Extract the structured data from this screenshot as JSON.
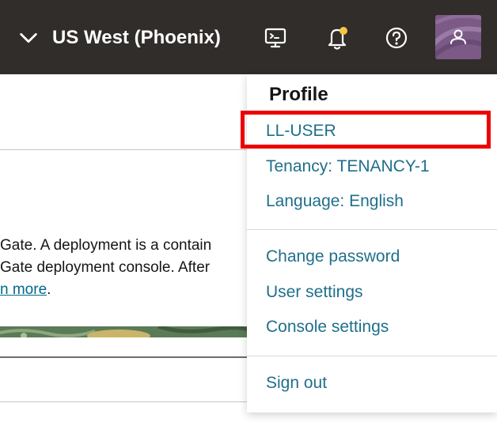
{
  "header": {
    "region_label": "US West (Phoenix)",
    "icons": [
      "cloud-shell-icon",
      "bell-icon",
      "help-icon",
      "user-icon"
    ]
  },
  "background": {
    "line1": "Gate. A deployment is a contain",
    "line2": "Gate deployment console. After",
    "link_text": "n more",
    "link_suffix": "."
  },
  "profile_menu": {
    "title": "Profile",
    "user": "LL-USER",
    "tenancy": "Tenancy: TENANCY-1",
    "language": "Language: English",
    "change_password": "Change password",
    "user_settings": "User settings",
    "console_settings": "Console settings",
    "sign_out": "Sign out"
  },
  "colors": {
    "header_bg": "#312d2a",
    "link": "#1f6f8b",
    "highlight": "#ee0000",
    "avatar": "#7b5a86"
  }
}
